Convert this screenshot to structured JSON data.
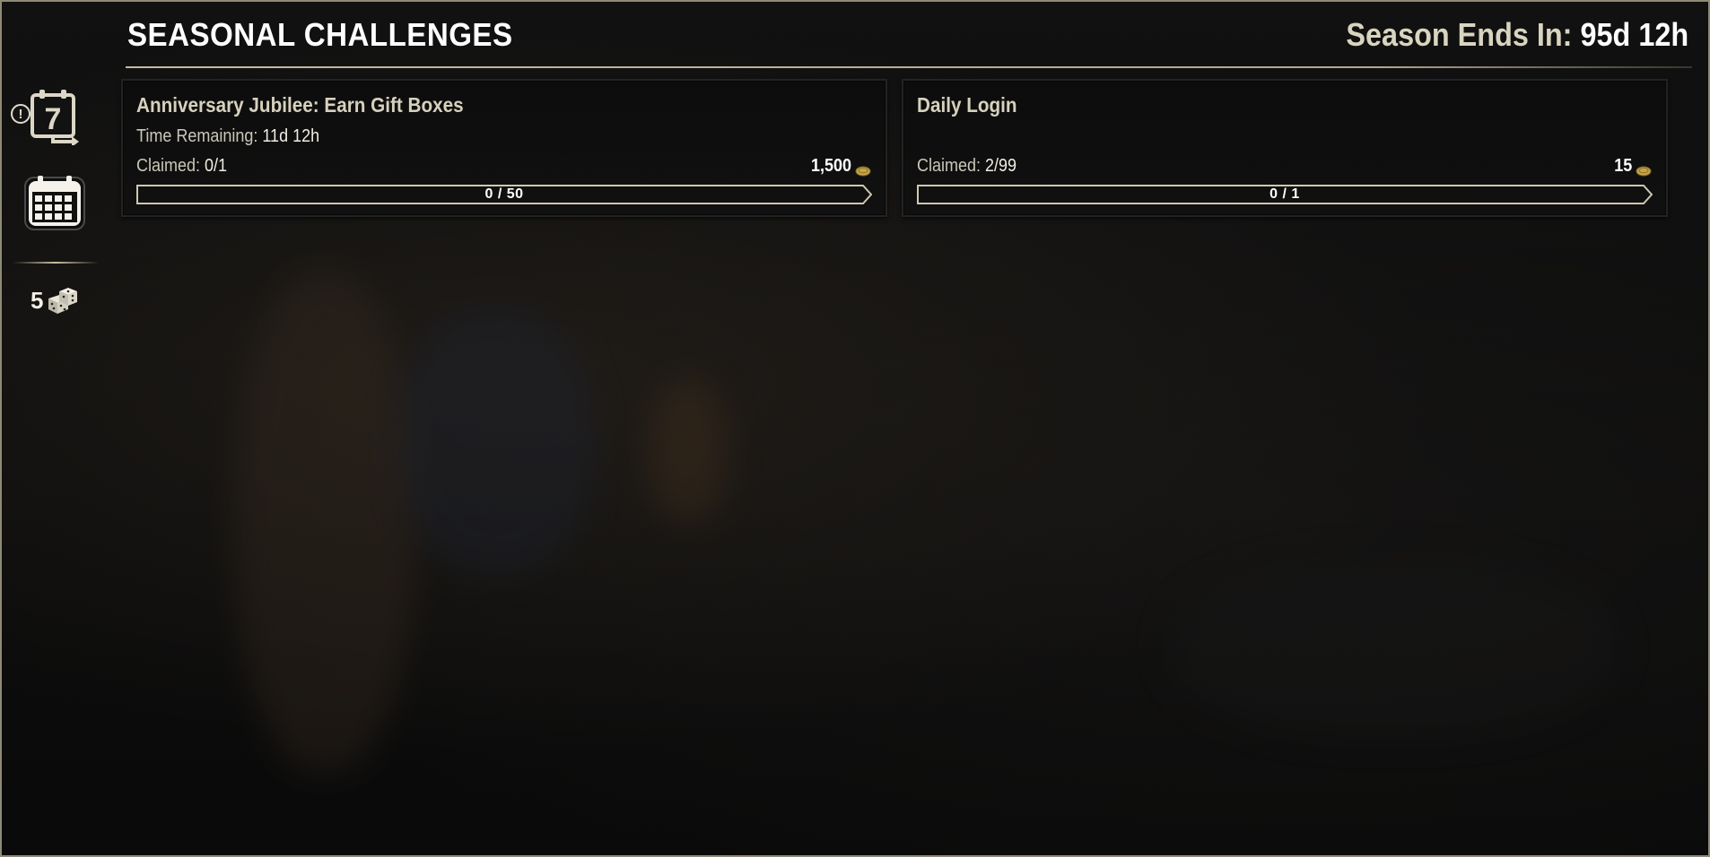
{
  "header": {
    "title": "SEASONAL CHALLENGES",
    "season_label": "Season Ends In:",
    "season_value": "95d 12h"
  },
  "left_rail": {
    "weekly_icon_number": "7",
    "alert_glyph": "!",
    "dice_count": "5",
    "icons": [
      "weekly-challenges-icon",
      "alert-icon",
      "calendar-icon",
      "dice-icon"
    ]
  },
  "challenges": [
    {
      "name": "Anniversary Jubilee: Earn Gift Boxes",
      "time_label": "Time Remaining:",
      "time_value": "11d 12h",
      "claimed_label": "Claimed:",
      "claimed_value": "0/1",
      "reward": "1,500",
      "reward_icon": "gold-coin-icon",
      "progress_text": "0 / 50",
      "progress_fraction": 0
    },
    {
      "name": "Daily Login",
      "time_label": "",
      "time_value": "",
      "claimed_label": "Claimed:",
      "claimed_value": "2/99",
      "reward": "15",
      "reward_icon": "gold-coin-icon",
      "progress_text": "0 / 1",
      "progress_fraction": 0
    }
  ],
  "colors": {
    "frame_border": "#8f8a76",
    "title_text": "#ffffff",
    "muted_text": "#d6d1bd",
    "coin": "#c9a64a",
    "progress_border": "#cfc8b0"
  }
}
